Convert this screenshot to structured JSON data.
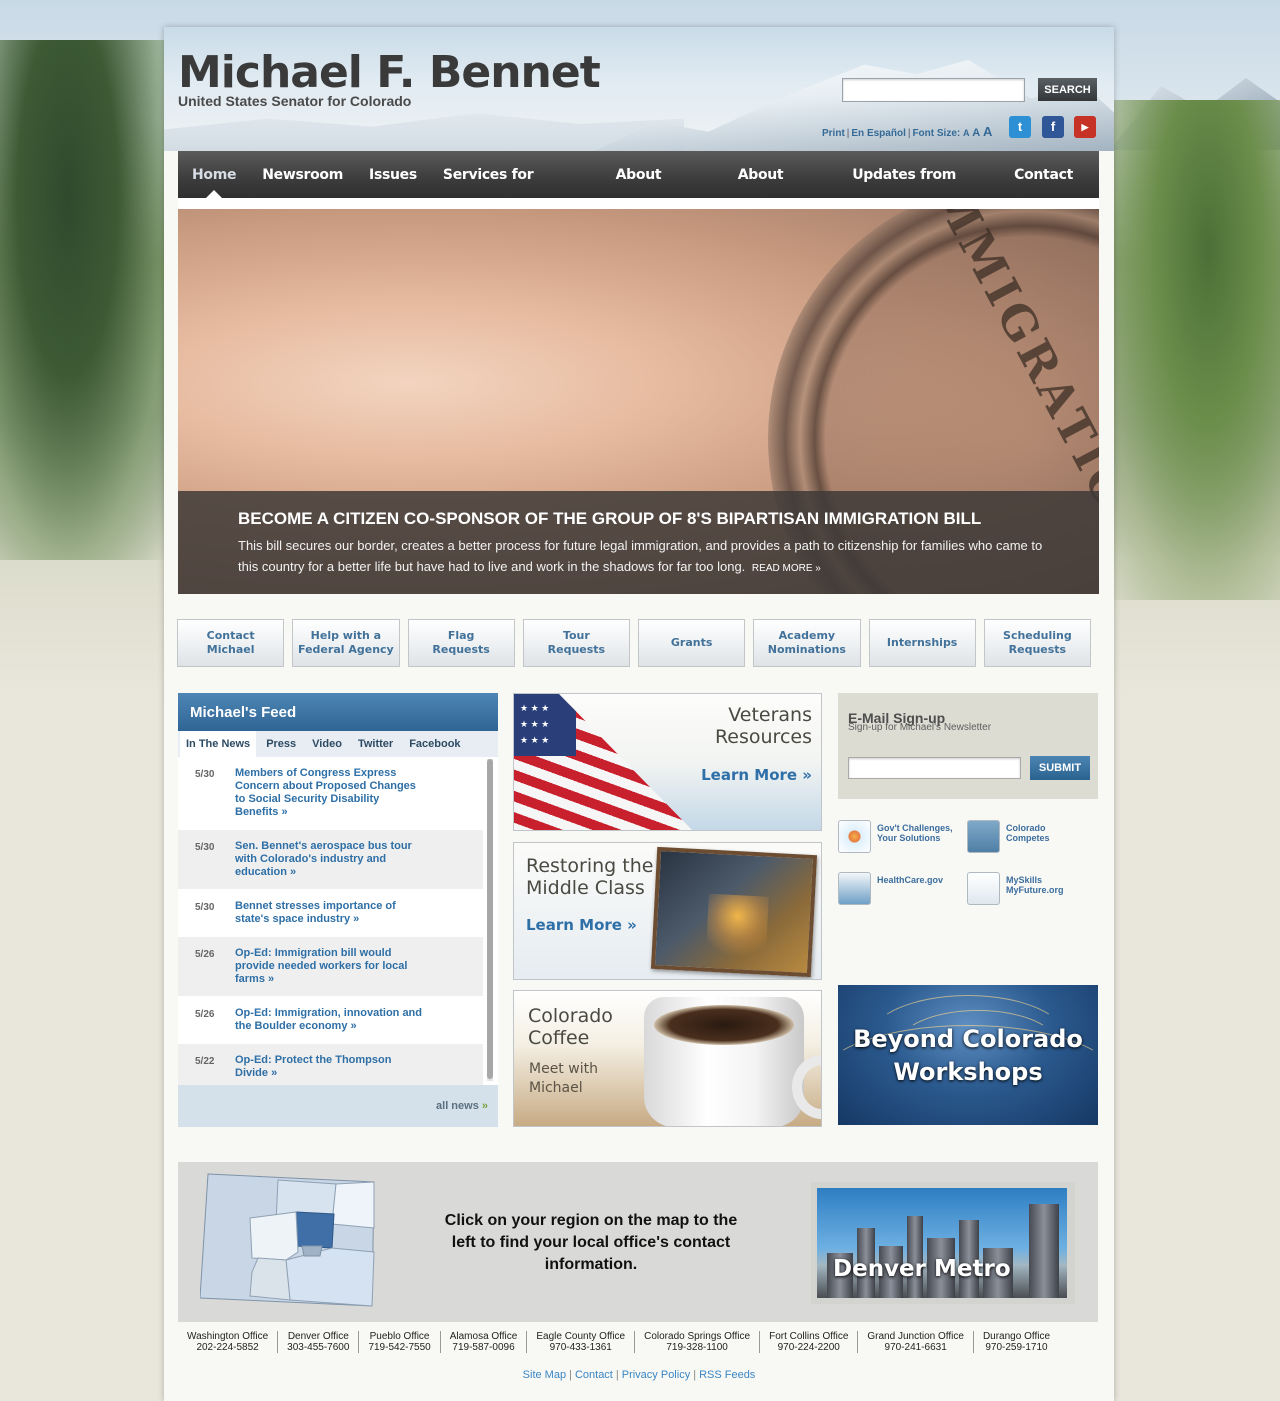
{
  "header": {
    "title": "Michael F. Bennet",
    "subtitle": "United States Senator for Colorado",
    "search_button": "SEARCH",
    "search_value": "",
    "utility": {
      "print": "Print",
      "espanol": "En Español",
      "font_size": "Font Size:",
      "sizes": [
        "A",
        "A",
        "A"
      ]
    },
    "social": [
      "twitter-icon",
      "facebook-icon",
      "youtube-icon"
    ]
  },
  "nav": {
    "items": [
      "Home",
      "Newsroom",
      "Issues",
      "Services for Coloradans",
      "About Colorado",
      "About Michael",
      "Updates from Michael",
      "Contact"
    ],
    "active": "Home"
  },
  "hero": {
    "title": "BECOME A CITIZEN CO-SPONSOR OF THE GROUP OF 8'S BIPARTISAN IMMIGRATION BILL",
    "text": "This bill secures our border, creates a better process for future legal immigration, and provides a path to citizenship for families who came to this country for a better life but have had to live and work in the shadows for far too long.",
    "more": "READ MORE »",
    "image_word": "IMMIGRATION"
  },
  "quick_links": [
    [
      "Contact",
      "Michael"
    ],
    [
      "Help with a",
      "Federal Agency"
    ],
    [
      "Flag",
      "Requests"
    ],
    [
      "Tour",
      "Requests"
    ],
    [
      "Grants"
    ],
    [
      "Academy",
      "Nominations"
    ],
    [
      "Internships"
    ],
    [
      "Scheduling",
      "Requests"
    ]
  ],
  "feed": {
    "title": "Michael's Feed",
    "tabs": [
      "In The News",
      "Press",
      "Video",
      "Twitter",
      "Facebook"
    ],
    "active_tab": "In The News",
    "items": [
      {
        "date": "5/30",
        "text": "Members of Congress Express Concern about Proposed Changes to Social Security Disability Benefits »"
      },
      {
        "date": "5/30",
        "text": "Sen. Bennet's aerospace bus tour with Colorado's industry and education »"
      },
      {
        "date": "5/30",
        "text": "Bennet stresses importance of state's space industry »"
      },
      {
        "date": "5/26",
        "text": "Op-Ed: Immigration bill would provide needed workers for local farms »"
      },
      {
        "date": "5/26",
        "text": "Op-Ed: Immigration, innovation and the Boulder economy »"
      },
      {
        "date": "5/22",
        "text": "Op-Ed: Protect the Thompson Divide »"
      }
    ],
    "all_news": "all news",
    "all_news_arrow": "»"
  },
  "promos": {
    "veterans": {
      "line1": "Veterans",
      "line2": "Resources",
      "more": "Learn More »"
    },
    "middle_class": {
      "line1": "Restoring the",
      "line2": "Middle Class",
      "more": "Learn More »"
    },
    "coffee": {
      "line1": "Colorado",
      "line2": "Coffee",
      "sub1": "Meet with",
      "sub2": "Michael"
    }
  },
  "signup": {
    "title": "E-Mail Sign-up",
    "subtitle": "Sign-up for Michael's Newsletter",
    "button": "SUBMIT",
    "value": ""
  },
  "external_links": [
    {
      "icon": "challenge-icon",
      "line1": "Gov't Challenges,",
      "line2": "Your Solutions"
    },
    {
      "icon": "colorado-competes-icon",
      "line1": "Colorado",
      "line2": "Competes"
    },
    {
      "icon": "healthcare-icon",
      "line1": "HealthCare.gov",
      "line2": ""
    },
    {
      "icon": "myskills-icon",
      "line1": "MySkills",
      "line2": "MyFuture.org"
    }
  ],
  "beyond": {
    "line1": "Beyond Colorado",
    "line2": "Workshops"
  },
  "map": {
    "instruction": "Click on your region on the map to the left to find your local office's contact information.",
    "region_label": "Denver Metro"
  },
  "offices": [
    {
      "name": "Washington Office",
      "phone": "202-224-5852"
    },
    {
      "name": "Denver Office",
      "phone": "303-455-7600"
    },
    {
      "name": "Pueblo Office",
      "phone": "719-542-7550"
    },
    {
      "name": "Alamosa Office",
      "phone": "719-587-0096"
    },
    {
      "name": "Eagle County Office",
      "phone": "970-433-1361"
    },
    {
      "name": "Colorado Springs Office",
      "phone": "719-328-1100"
    },
    {
      "name": "Fort Collins Office",
      "phone": "970-224-2200"
    },
    {
      "name": "Grand Junction Office",
      "phone": "970-241-6631"
    },
    {
      "name": "Durango Office",
      "phone": "970-259-1710"
    }
  ],
  "footer": [
    "Site Map",
    "Contact",
    "Privacy Policy",
    "RSS Feeds"
  ],
  "colors": {
    "nav_bg": "#3c3c3c",
    "link_blue": "#2e6fa6",
    "feed_header": "#3a73a3"
  }
}
